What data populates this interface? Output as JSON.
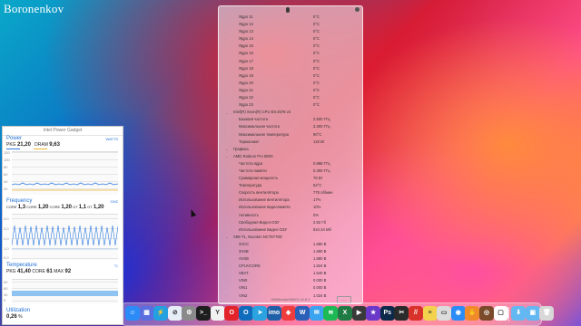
{
  "watermark": "Boronenkov",
  "intel_power_gadget": {
    "title": "Intel Power Gadget",
    "power": {
      "header": "Power",
      "unit": "WATTS",
      "pkg_label": "PKG",
      "pkg_value": "21,20",
      "dram_label": "DRAM",
      "dram_value": "9,63",
      "y_ticks": [
        "120",
        "100",
        "80",
        "60",
        "40",
        "20",
        "0"
      ]
    },
    "frequency": {
      "header": "Frequency",
      "unit": "GHZ",
      "items": [
        {
          "label": "CORE",
          "value": "1,3"
        },
        {
          "label": "CORE",
          "value": "1,20"
        },
        {
          "label": "CORE",
          "value": "1,20"
        },
        {
          "label": "GT",
          "value": "1,1"
        },
        {
          "label": "GT",
          "value": "1,20"
        }
      ],
      "y_ticks": [
        "4,0",
        "3,0",
        "2,0",
        "1,0",
        "0,0"
      ]
    },
    "temperature": {
      "header": "Temperature",
      "unit": "°C",
      "pkg_label": "PKG",
      "pkg_value": "41,40",
      "core_label": "CORE",
      "core_value": "61",
      "max_label": "MAX",
      "max_value": "92",
      "y_ticks": [
        "90",
        "60",
        "30",
        "0"
      ]
    },
    "utilization": {
      "header": "Utilization",
      "value": "0,26",
      "unit": "%"
    }
  },
  "hwmonitor": {
    "rows": [
      {
        "label": "Ядро 11",
        "value": "0°C",
        "type": "item"
      },
      {
        "label": "Ядро 12",
        "value": "0°C",
        "type": "item"
      },
      {
        "label": "Ядро 13",
        "value": "0°C",
        "type": "item"
      },
      {
        "label": "Ядро 14",
        "value": "0°C",
        "type": "item"
      },
      {
        "label": "Ядро 15",
        "value": "0°C",
        "type": "item"
      },
      {
        "label": "Ядро 16",
        "value": "0°C",
        "type": "item"
      },
      {
        "label": "Ядро 17",
        "value": "0°C",
        "type": "item"
      },
      {
        "label": "Ядро 18",
        "value": "0°C",
        "type": "item"
      },
      {
        "label": "Ядро 19",
        "value": "0°C",
        "type": "item"
      },
      {
        "label": "Ядро 20",
        "value": "0°C",
        "type": "item"
      },
      {
        "label": "Ядро 21",
        "value": "0°C",
        "type": "item"
      },
      {
        "label": "Ядро 22",
        "value": "0°C",
        "type": "item"
      },
      {
        "label": "Ядро 23",
        "value": "0°C",
        "type": "item"
      },
      {
        "label": "Intel(R) Xeon(R) CPU E5-2678 v3",
        "value": "",
        "type": "group"
      },
      {
        "label": "Базовая частота",
        "value": "2.500 ГГц",
        "type": "item"
      },
      {
        "label": "Максимальная частота",
        "value": "3.300 ГГц",
        "type": "item"
      },
      {
        "label": "Максимальная температура",
        "value": "90°C",
        "type": "item"
      },
      {
        "label": "Термопакет",
        "value": "120 Вт",
        "type": "item"
      },
      {
        "label": "Графика",
        "value": "",
        "type": "group"
      },
      {
        "label": "AMD Radeon Pro 580X",
        "value": "",
        "type": "group"
      },
      {
        "label": "Частота ядра",
        "value": "0.888 ГГц",
        "type": "item"
      },
      {
        "label": "Частота памяти",
        "value": "0.300 ГГц",
        "type": "item"
      },
      {
        "label": "Суммарная мощность",
        "value": "76 Вт",
        "type": "item"
      },
      {
        "label": "Температура",
        "value": "52°C",
        "type": "item"
      },
      {
        "label": "Скорость вентилятора",
        "value": "776 об/мин",
        "type": "item"
      },
      {
        "label": "Использование вентилятора",
        "value": "17%",
        "type": "item"
      },
      {
        "label": "Использование видеопамяти",
        "value": "10%",
        "type": "item"
      },
      {
        "label": "Активность",
        "value": "0%",
        "type": "item"
      },
      {
        "label": "Свободная Видео-ОЗУ",
        "value": "2.82 Гб",
        "type": "item"
      },
      {
        "label": "Использование Видео-ОЗУ",
        "value": "624.34 Мб",
        "type": "item"
      },
      {
        "label": "X99-T1, Nuvoton NCT6779D",
        "value": "",
        "type": "group"
      },
      {
        "label": "3VCC",
        "value": "1.680 В",
        "type": "item"
      },
      {
        "label": "3VSB",
        "value": "1.680 В",
        "type": "item"
      },
      {
        "label": "AVSB",
        "value": "1.680 В",
        "type": "item"
      },
      {
        "label": "CPUVCORE",
        "value": "1.824 В",
        "type": "item"
      },
      {
        "label": "VBAT",
        "value": "1.640 В",
        "type": "item"
      },
      {
        "label": "VIN0",
        "value": "0.000 В",
        "type": "item"
      },
      {
        "label": "VIN1",
        "value": "0.000 В",
        "type": "item"
      },
      {
        "label": "VIN2",
        "value": "1.024 В",
        "type": "item"
      }
    ],
    "footer": "HWMonitorSMC2 v2.8.1",
    "footer_button": "−−−"
  },
  "dock": {
    "apps": [
      {
        "name": "finder-icon",
        "color": "#2b8cf7",
        "glyph": "☺"
      },
      {
        "name": "launchpad-icon",
        "color": "#5a6ee0",
        "glyph": "▦"
      },
      {
        "name": "system-monitor-icon",
        "color": "#22a0e0",
        "glyph": "⚡"
      },
      {
        "name": "safari-icon",
        "color": "#e8eef8",
        "glyph": "⊘"
      },
      {
        "name": "settings-icon",
        "color": "#8a8a8a",
        "glyph": "⚙"
      },
      {
        "name": "terminal-icon",
        "color": "#1e1e1e",
        "glyph": ">_"
      },
      {
        "name": "yandex-browser-icon",
        "color": "#f2f2f2",
        "glyph": "Y"
      },
      {
        "name": "opera-icon",
        "color": "#e2232a",
        "glyph": "O"
      },
      {
        "name": "outlook-icon",
        "color": "#0f6cbd",
        "glyph": "O"
      },
      {
        "name": "telegram-icon",
        "color": "#2aa3e0",
        "glyph": "➤"
      },
      {
        "name": "imo-icon",
        "color": "#1f5fa8",
        "glyph": "imo"
      },
      {
        "name": "any-desk-icon",
        "color": "#ef3c3c",
        "glyph": "◆"
      },
      {
        "name": "word-icon",
        "color": "#2b5fb8",
        "glyph": "W"
      },
      {
        "name": "mail-icon",
        "color": "#3aa4f0",
        "glyph": "✉"
      },
      {
        "name": "spotify-icon",
        "color": "#1db954",
        "glyph": "≋"
      },
      {
        "name": "excel-icon",
        "color": "#1f7a43",
        "glyph": "X"
      },
      {
        "name": "media-player-icon",
        "color": "#3a3a3a",
        "glyph": "▶"
      },
      {
        "name": "imovie-icon",
        "color": "#6a39c9",
        "glyph": "★"
      },
      {
        "name": "photoshop-icon",
        "color": "#0d2a4a",
        "glyph": "Ps"
      },
      {
        "name": "finalcut-icon",
        "color": "#2b2b2b",
        "glyph": "✂"
      },
      {
        "name": "parallels-icon",
        "color": "#d9322b",
        "glyph": "//"
      },
      {
        "name": "notes-icon",
        "color": "#f3d24d",
        "glyph": "≡"
      },
      {
        "name": "finder-window-icon",
        "color": "#dcdcdc",
        "glyph": "▭"
      },
      {
        "name": "activity-monitor-icon",
        "color": "#2b8cf7",
        "glyph": "◉"
      },
      {
        "name": "paw-app-icon",
        "color": "#f08a2b",
        "glyph": "✋"
      },
      {
        "name": "wheel-app-icon",
        "color": "#7a4a2a",
        "glyph": "◎"
      },
      {
        "name": "calendar-icon",
        "color": "#ffffff",
        "glyph": "▢"
      }
    ],
    "folders": [
      {
        "name": "downloads-folder-icon",
        "color": "#63b8f2",
        "glyph": "⬇"
      },
      {
        "name": "screenshots-folder-icon",
        "color": "#63b8f2",
        "glyph": "▣"
      },
      {
        "name": "trash-icon",
        "color": "#d8d8d8",
        "glyph": "🗑"
      }
    ]
  }
}
